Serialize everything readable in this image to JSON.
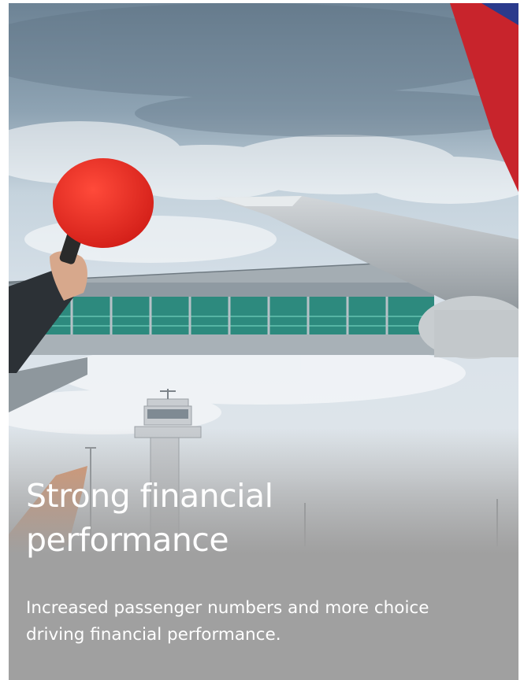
{
  "hero": {
    "title_line_1": "Strong financial",
    "title_line_2": "performance",
    "subtitle_line_1": "Increased passenger numbers and more choice",
    "subtitle_line_2": "driving financial performance."
  },
  "colors": {
    "overlay": "#a0a0a0",
    "text": "#ffffff",
    "paddle": "#e8241f"
  }
}
